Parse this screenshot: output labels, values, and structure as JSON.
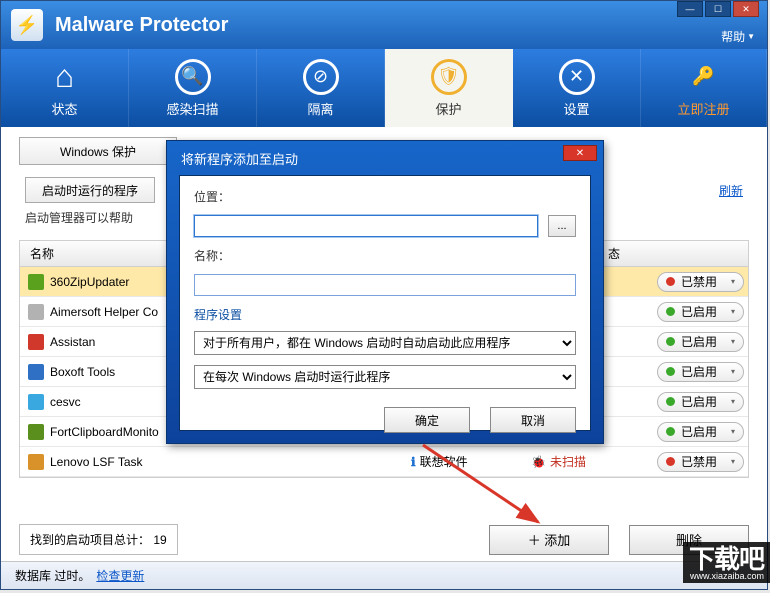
{
  "app": {
    "title": "Malware Protector",
    "help": "帮助"
  },
  "win": {
    "min": "—",
    "max": "☐",
    "close": "✕"
  },
  "toolbar": {
    "items": [
      {
        "label": "状态",
        "iconGlyph": "⌂"
      },
      {
        "label": "感染扫描",
        "iconGlyph": "🔍"
      },
      {
        "label": "隔离",
        "iconGlyph": "⊘"
      },
      {
        "label": "保护",
        "iconGlyph": "🛡"
      },
      {
        "label": "设置",
        "iconGlyph": "✕"
      },
      {
        "label": "立即注册",
        "iconGlyph": "🔑"
      }
    ]
  },
  "tabs": {
    "primary": "Windows 保护"
  },
  "subheader": {
    "btn": "启动时运行的程序",
    "refresh": "刷新"
  },
  "desc": "启动管理器可以帮助",
  "table": {
    "headers": {
      "name": "名称",
      "status": "态"
    },
    "rows": [
      {
        "name": "360ZipUpdater",
        "color": "#5aa11e",
        "company": "",
        "scan": "",
        "status": "已禁用",
        "dot": "red",
        "sel": true
      },
      {
        "name": "Aimersoft Helper Co",
        "color": "#b2b2b2",
        "company": "",
        "scan": "",
        "status": "已启用",
        "dot": "green"
      },
      {
        "name": "Assistan",
        "color": "#d0382b",
        "company": "",
        "scan": "",
        "status": "已启用",
        "dot": "green"
      },
      {
        "name": "Boxoft Tools",
        "color": "#2f70c4",
        "company": "",
        "scan": "",
        "status": "已启用",
        "dot": "green"
      },
      {
        "name": "cesvc",
        "color": "#3aa8e0",
        "company": "",
        "scan": "",
        "status": "已启用",
        "dot": "green"
      },
      {
        "name": "FortClipboardMonito",
        "color": "#5a8f1e",
        "company": "",
        "scan": "",
        "status": "已启用",
        "dot": "green"
      },
      {
        "name": "Lenovo LSF Task",
        "color": "#d9912a",
        "company": "联想软件",
        "scan": "未扫描",
        "status": "已禁用",
        "dot": "red"
      }
    ]
  },
  "footer": {
    "totalLabel": "找到的启动项目总计：",
    "totalValue": "19",
    "add": "＋ 添加",
    "del": "删除"
  },
  "statusbar": {
    "db": "数据库 过时。",
    "update": "检查更新"
  },
  "modal": {
    "title": "将新程序添加至启动",
    "locationLabel": "位置：",
    "locationValue": "",
    "browse": "...",
    "nameLabel": "名称：",
    "nameValue": "",
    "section": "程序设置",
    "select1": "对于所有用户，都在 Windows 启动时自动启动此应用程序",
    "select2": "在每次 Windows 启动时运行此程序",
    "ok": "确定",
    "cancel": "取消",
    "close": "✕"
  },
  "watermark": {
    "big": "下载吧",
    "url": "www.xiazaiba.com"
  }
}
